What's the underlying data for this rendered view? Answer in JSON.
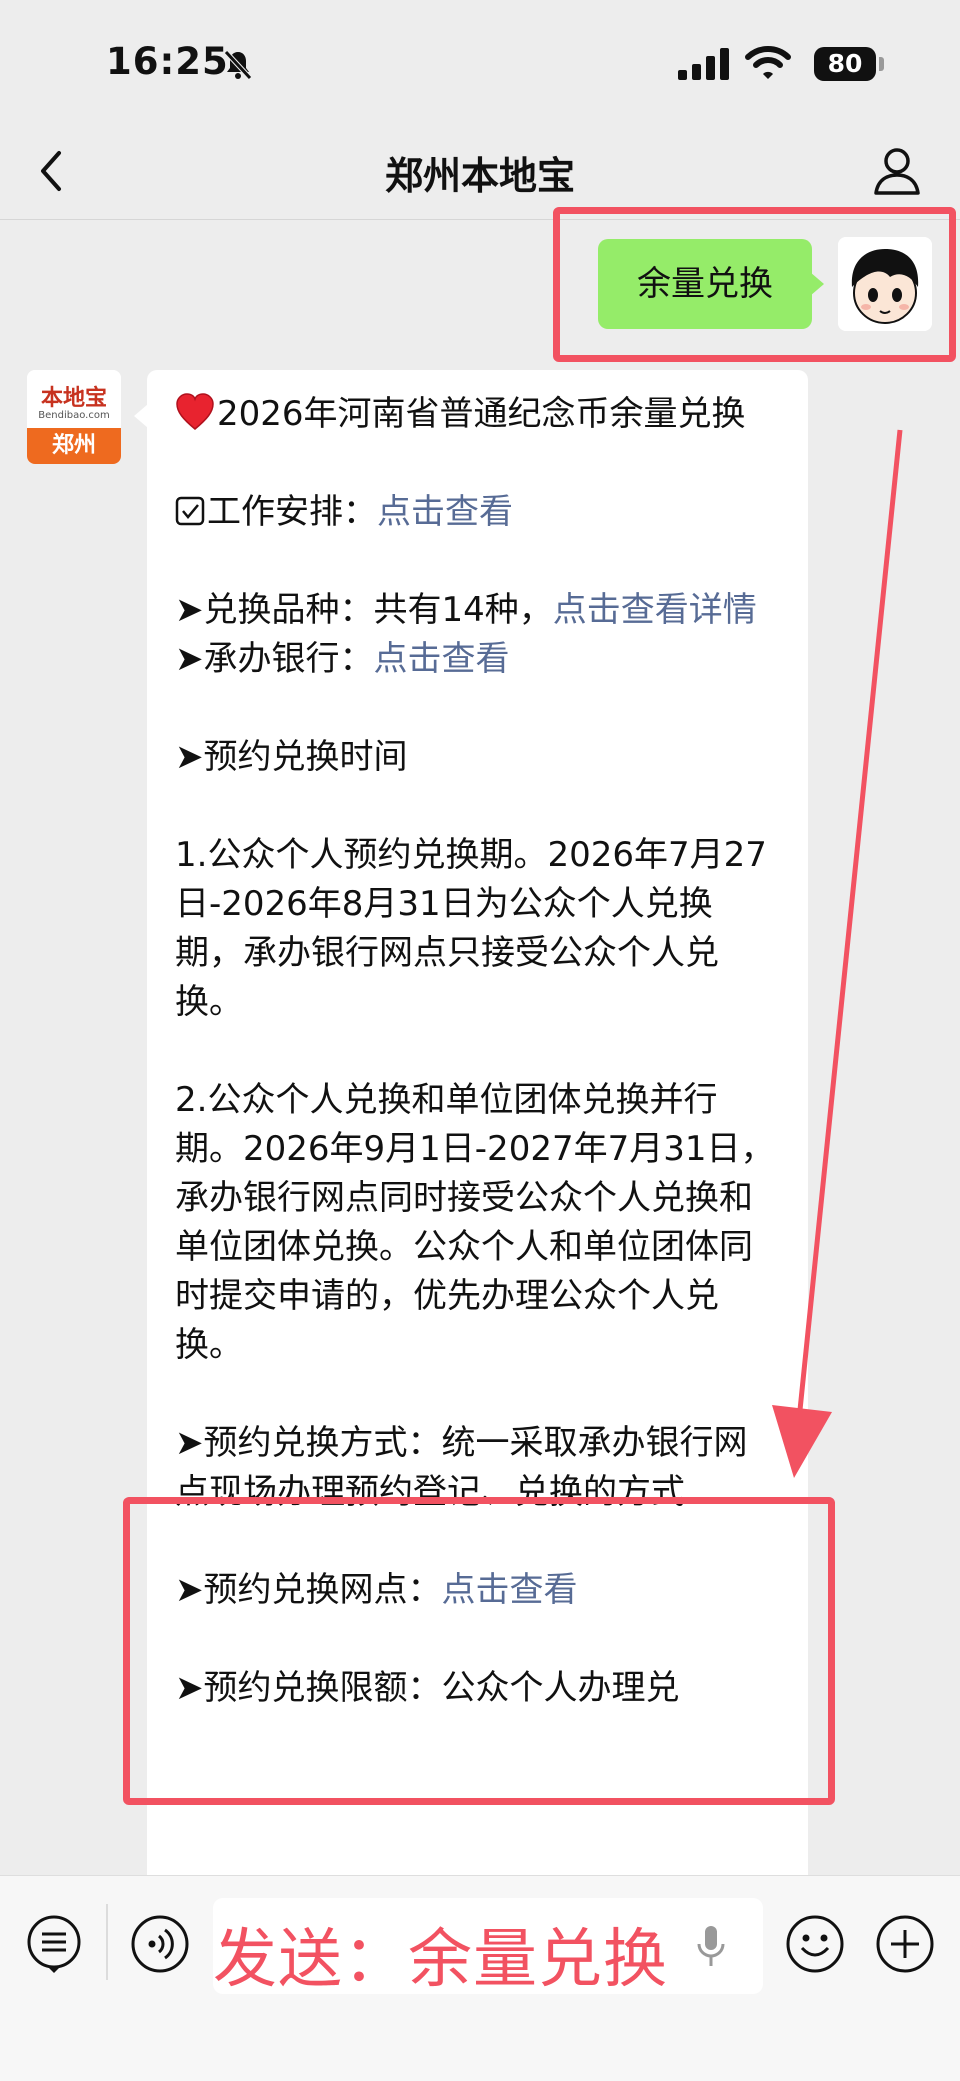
{
  "status_bar": {
    "time": "16:25",
    "battery": "80"
  },
  "nav": {
    "title": "郑州本地宝"
  },
  "sent_message": {
    "text": "余量兑换"
  },
  "bot_avatar": {
    "brand": "本地宝",
    "site": "Bendibao.com",
    "city": "郑州"
  },
  "message": {
    "title": "2026年河南省普通纪念币余量兑换",
    "work_prefix": "工作安排：",
    "work_link": "点击查看",
    "variety_prefix": "➤兑换品种：共有14种，",
    "variety_link": "点击查看详情",
    "bank_prefix": "➤承办银行：",
    "bank_link": "点击查看",
    "time_heading": "➤预约兑换时间",
    "para1": "1.公众个人预约兑换期。2026年7月27日-2026年8月31日为公众个人兑换期，承办银行网点只接受公众个人兑换。",
    "para2": "2.公众个人兑换和单位团体兑换并行期。2026年9月1日-2027年7月31日，承办银行网点同时接受公众个人兑换和单位团体兑换。公众个人和单位团体同时提交申请的，优先办理公众个人兑换。",
    "method": "➤预约兑换方式：统一采取承办银行网点现场办理预约登记、兑换的方式",
    "outlet_prefix": "➤预约兑换网点：",
    "outlet_link": "点击查看",
    "limit": "➤预约兑换限额：公众个人办理兑"
  },
  "input_bar": {
    "text": "发送：余量兑换"
  },
  "colors": {
    "highlight": "#f25261",
    "bubble_sent": "#95ec69",
    "link": "#576b95"
  }
}
